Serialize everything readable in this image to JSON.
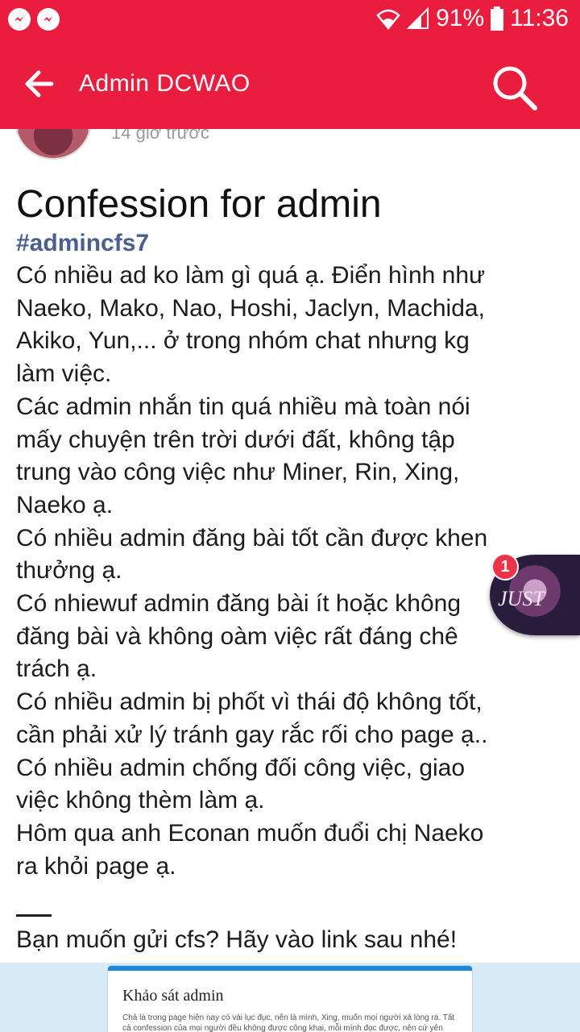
{
  "status_bar": {
    "battery": "91%",
    "time": "11:36",
    "icons": [
      "messenger-icon",
      "messenger-icon",
      "wifi-icon",
      "signal-icon",
      "battery-icon"
    ]
  },
  "app_bar": {
    "title": "Admin DCWAO",
    "back_icon": "arrow-left-icon",
    "search_icon": "search-icon",
    "color": "#eb1d3f"
  },
  "post": {
    "time": "14 giờ trước",
    "title": "Confession for admin",
    "hashtag": "#admincfs7",
    "lines": [
      "Có nhiều ad ko làm gì quá ạ. Điển hình như",
      "Naeko, Mako, Nao, Hoshi, Jaclyn, Machida,",
      "Akiko, Yun,... ở trong nhóm chat nhưng kg",
      "làm việc.",
      "Các admin nhắn tin quá nhiều mà toàn nói",
      "mấy chuyện trên trời dưới đất, không tập",
      "trung vào công việc như Miner, Rin, Xing,",
      "Naeko ạ.",
      "Có nhiều admin đăng bài tốt cần được khen",
      "thưởng ạ.",
      "Có nhiewuf admin đăng bài ít hoặc không",
      "đăng bài và không oàm việc rất đáng chê",
      "trách ạ.",
      "Có nhiều admin bị phốt vì thái độ không tốt,",
      "cần phải xử lý tránh gay rắc rối cho page ạ..",
      "Có nhiều admin chống đối công việc, giao",
      "việc không thèm làm ạ.",
      "Hôm qua anh Econan muốn đuổi chị Naeko",
      "ra khỏi page ạ."
    ],
    "divider": "——",
    "link_prompt": "Bạn muốn gửi cfs? Hãy vào link sau nhé!"
  },
  "link_preview": {
    "title": "Khảo sát admin",
    "text": "Chả là trong page hiện nay có vài lục đục, nên là mình, Xing, muốn mọi người xả lòng ra. Tất cả confession của mọi người đều không được công khai, mỗi mình đọc được, nên cứ yên"
  },
  "chat_head": {
    "label": "JUST",
    "badge": "1"
  }
}
